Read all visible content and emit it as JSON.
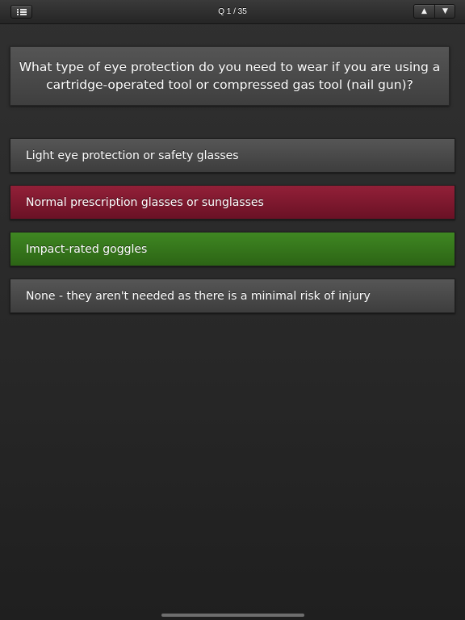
{
  "header": {
    "counter": "Q 1 / 35",
    "menu_icon": "list-icon",
    "prev_icon": "triangle-up-icon",
    "next_icon": "triangle-down-icon",
    "prev_glyph": "▲",
    "next_glyph": "▼"
  },
  "question": {
    "text": "What type of eye protection do you need to wear if you are using a cartridge-operated tool or compressed gas tool (nail gun)?"
  },
  "answers": [
    {
      "text": "Light eye protection or safety glasses",
      "state": "neutral"
    },
    {
      "text": "Normal prescription glasses or sunglasses",
      "state": "wrong"
    },
    {
      "text": "Impact-rated goggles",
      "state": "correct"
    },
    {
      "text": "None - they aren't needed as there is a minimal risk of injury",
      "state": "neutral"
    }
  ],
  "colors": {
    "background": "#2a2a2a",
    "neutral": "#4a4a4a",
    "wrong": "#7e1930",
    "correct": "#36761c"
  }
}
